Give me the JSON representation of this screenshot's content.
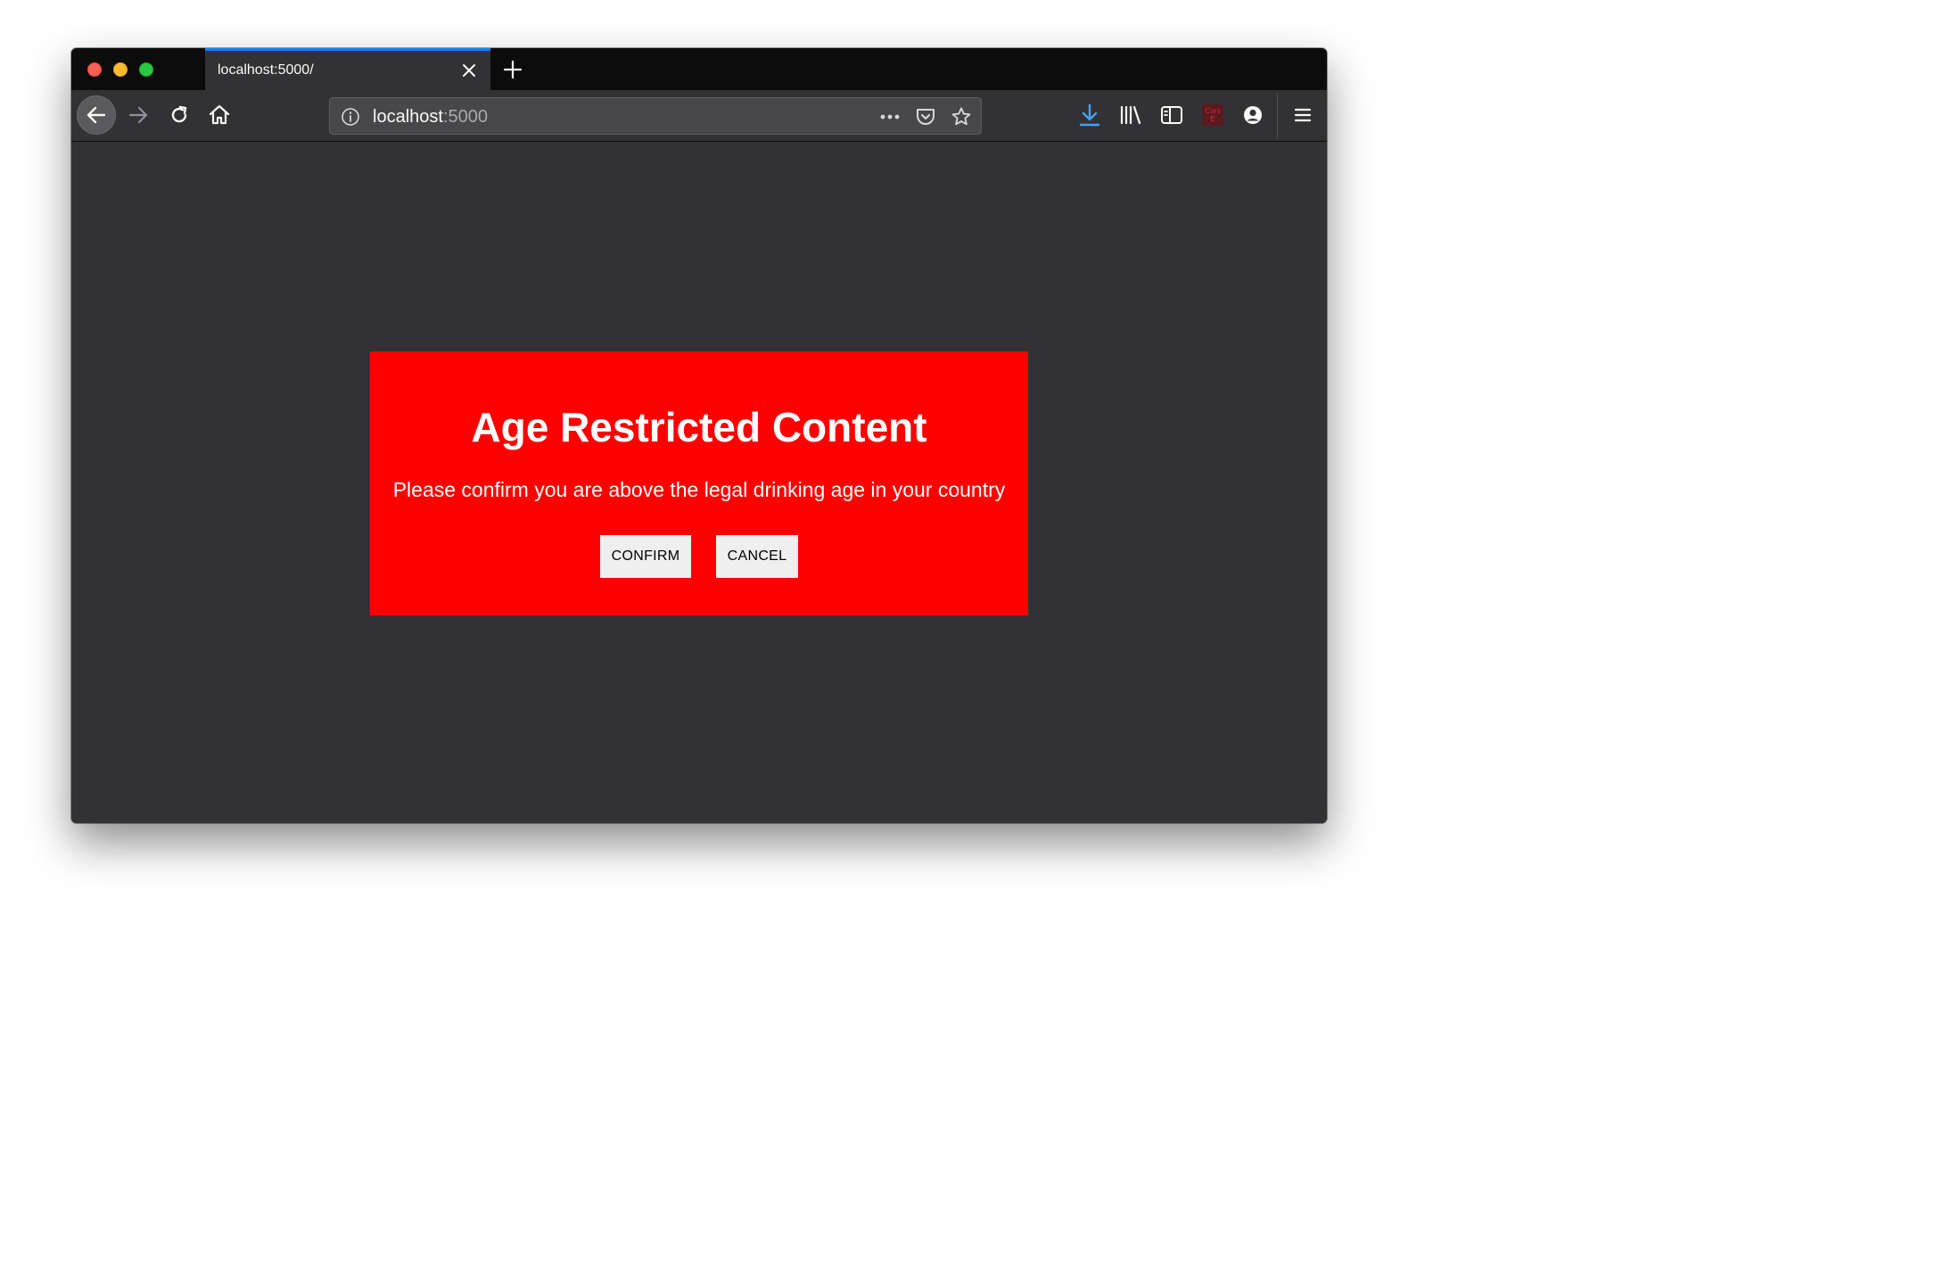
{
  "browser": {
    "tab": {
      "title": "localhost:5000/"
    },
    "url": {
      "host": "localhost",
      "port": ":5000"
    },
    "icons": {
      "close": "close-icon",
      "new_tab": "plus-icon",
      "back": "arrow-left-icon",
      "forward": "arrow-right-icon",
      "reload": "reload-icon",
      "home": "home-icon",
      "info": "info-icon",
      "more": "ellipsis-icon",
      "pocket": "pocket-icon",
      "bookmark": "star-icon",
      "download": "download-icon",
      "library": "library-icon",
      "sidebar": "sidebar-icon",
      "account": "account-icon",
      "menu": "hamburger-menu-icon"
    },
    "extension": {
      "label_top": "Cors",
      "label_bottom": "E"
    },
    "colors": {
      "accent": "#0a84ff",
      "download": "#45a1ff",
      "chrome": "#323234",
      "tabstrip": "#0c0c0d"
    }
  },
  "modal": {
    "title": "Age Restricted Content",
    "message": "Please confirm you are above the legal drinking age in your country",
    "confirm_label": "CONFIRM",
    "cancel_label": "CANCEL",
    "background": "#ff0000"
  }
}
